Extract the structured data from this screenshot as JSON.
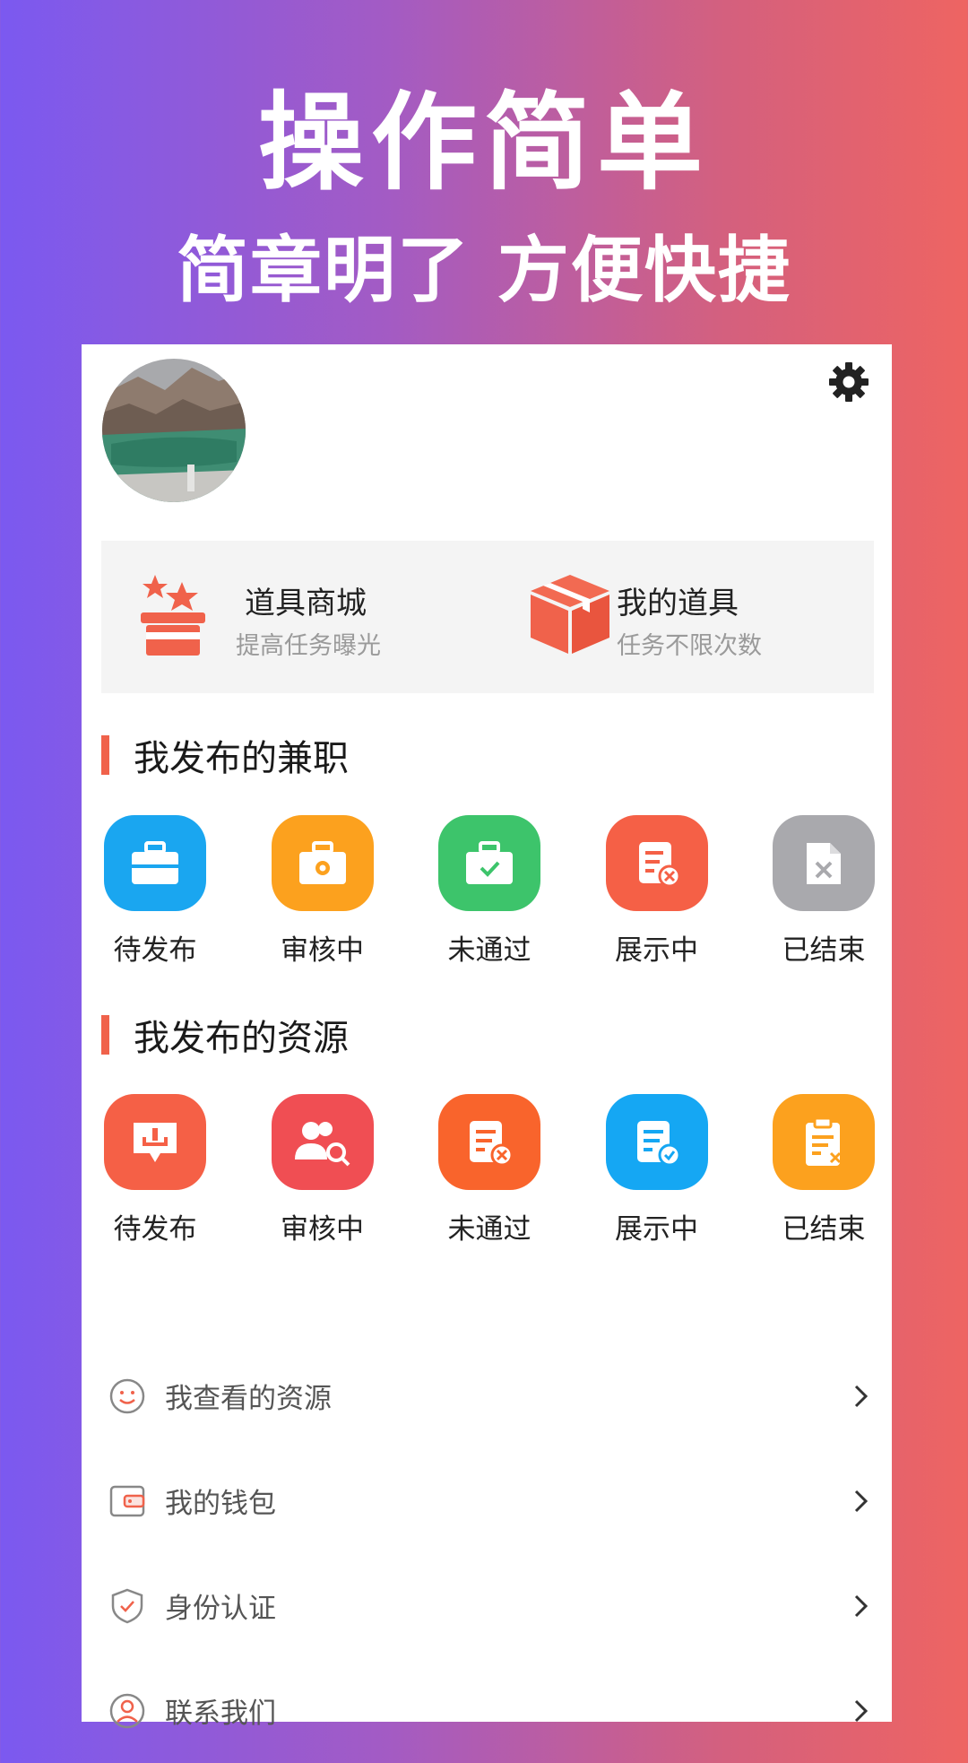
{
  "promo": {
    "headline": "操作简单",
    "subline": "简章明了 方便快捷"
  },
  "profile": {
    "avatar_icon": "avatar-photo",
    "settings_icon": "gear-icon"
  },
  "tools": [
    {
      "title": "道具商城",
      "subtitle": "提高任务曝光",
      "icon": "magic-hat-icon"
    },
    {
      "title": "我的道具",
      "subtitle": "任务不限次数",
      "icon": "box-icon"
    }
  ],
  "jobs_section": {
    "title": "我发布的兼职",
    "items": [
      {
        "label": "待发布",
        "icon": "briefcase-icon",
        "color": "#1aa6f0"
      },
      {
        "label": "审核中",
        "icon": "briefcase-gear-icon",
        "color": "#fca11e"
      },
      {
        "label": "未通过",
        "icon": "briefcase-check-icon",
        "color": "#3dc46b"
      },
      {
        "label": "展示中",
        "icon": "document-x-icon",
        "color": "#f56046"
      },
      {
        "label": "已结束",
        "icon": "file-x-icon",
        "color": "#a9a9ad"
      }
    ]
  },
  "resources_section": {
    "title": "我发布的资源",
    "items": [
      {
        "label": "待发布",
        "icon": "message-upload-icon",
        "color": "#f56046"
      },
      {
        "label": "审核中",
        "icon": "users-search-icon",
        "color": "#f04e53"
      },
      {
        "label": "未通过",
        "icon": "document-x-icon",
        "color": "#f9642c"
      },
      {
        "label": "展示中",
        "icon": "document-check-icon",
        "color": "#15a7f3"
      },
      {
        "label": "已结束",
        "icon": "clipboard-x-icon",
        "color": "#fca11e"
      }
    ]
  },
  "menu": [
    {
      "label": "我查看的资源",
      "icon": "smile-icon"
    },
    {
      "label": "我的钱包",
      "icon": "wallet-icon"
    },
    {
      "label": "身份认证",
      "icon": "shield-check-icon"
    },
    {
      "label": "联系我们",
      "icon": "user-circle-icon"
    }
  ]
}
